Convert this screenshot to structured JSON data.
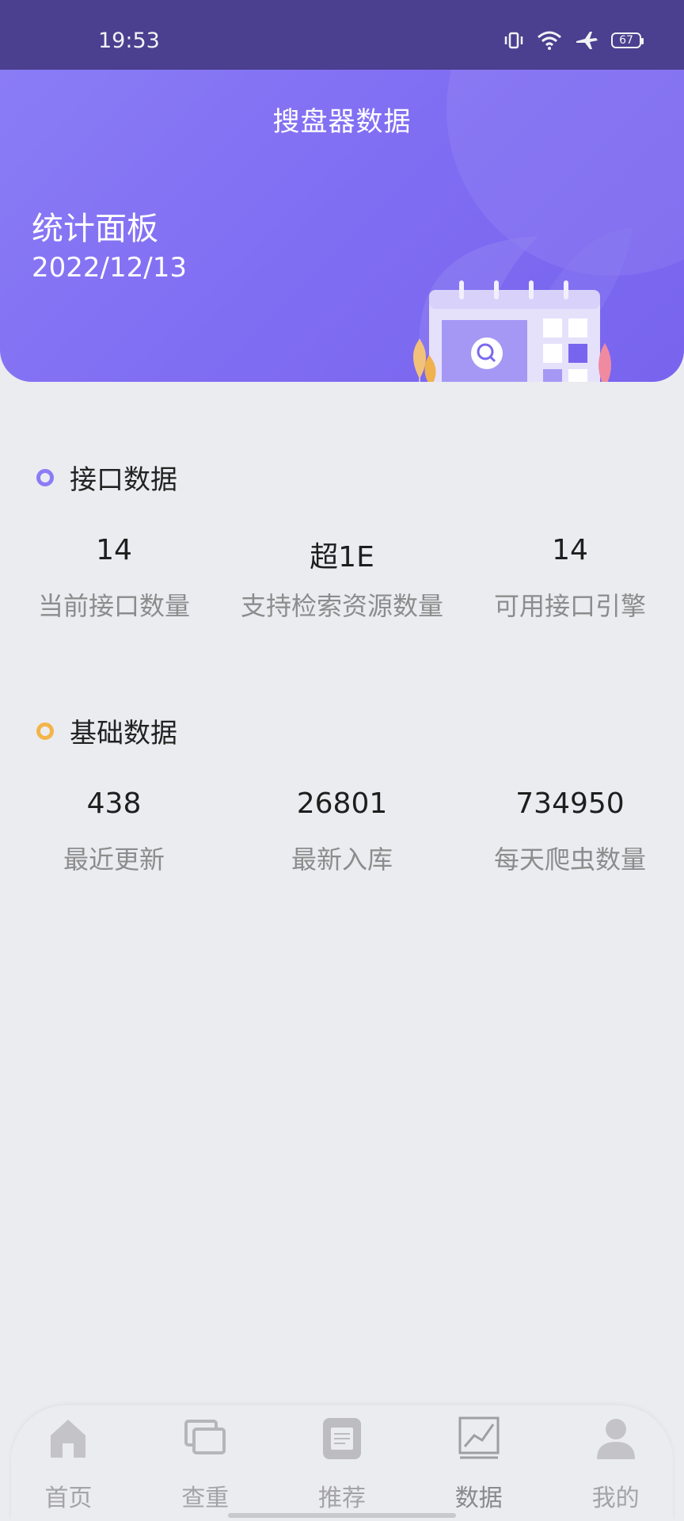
{
  "status_bar": {
    "time": "19:53",
    "battery": "67",
    "icons": [
      "vibrate-icon",
      "wifi-icon",
      "airplane-icon",
      "battery-icon"
    ]
  },
  "header": {
    "title": "搜盘器数据",
    "panel_title": "统计面板",
    "date": "2022/12/13"
  },
  "sections": {
    "interface": {
      "title": "接口数据",
      "accent": "#8a7cf5",
      "stats": [
        {
          "value": "14",
          "label": "当前接口数量"
        },
        {
          "value": "超1E",
          "label": "支持检索资源数量"
        },
        {
          "value": "14",
          "label": "可用接口引擎"
        }
      ]
    },
    "basic": {
      "title": "基础数据",
      "accent": "#f3b54a",
      "stats": [
        {
          "value": "438",
          "label": "最近更新"
        },
        {
          "value": "26801",
          "label": "最新入库"
        },
        {
          "value": "734950",
          "label": "每天爬虫数量"
        }
      ]
    }
  },
  "tabbar": {
    "items": [
      {
        "label": "首页",
        "icon": "home-icon"
      },
      {
        "label": "查重",
        "icon": "duplicate-check-icon"
      },
      {
        "label": "推荐",
        "icon": "recommend-icon"
      },
      {
        "label": "数据",
        "icon": "chart-icon",
        "active": true
      },
      {
        "label": "我的",
        "icon": "user-icon"
      }
    ]
  },
  "colors": {
    "header_gradient_start": "#8a7cf5",
    "header_gradient_end": "#7864ee",
    "status_bar": "#4b3f8f",
    "background": "#ebecf0"
  }
}
